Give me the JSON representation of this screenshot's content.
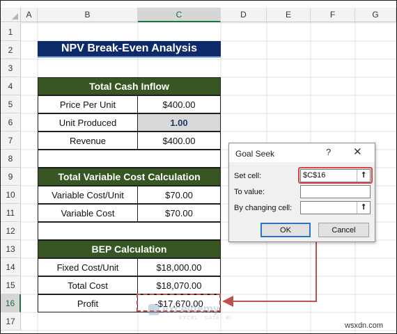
{
  "columns": [
    "A",
    "B",
    "C",
    "D",
    "E",
    "F",
    "G"
  ],
  "rows": [
    "1",
    "2",
    "3",
    "4",
    "5",
    "6",
    "7",
    "8",
    "9",
    "10",
    "11",
    "12",
    "13",
    "14",
    "15",
    "16",
    "17"
  ],
  "title": "NPV Break-Even Analysis",
  "sections": {
    "cash_inflow": {
      "header": "Total Cash Inflow",
      "rows": [
        {
          "label": "Price Per Unit",
          "value": "$400.00"
        },
        {
          "label": "Unit Produced",
          "value": "1.00"
        },
        {
          "label": "Revenue",
          "value": "$400.00"
        }
      ]
    },
    "variable_cost": {
      "header": "Total Variable Cost Calculation",
      "rows": [
        {
          "label": "Variable Cost/Unit",
          "value": "$70.00"
        },
        {
          "label": "Variable Cost",
          "value": "$70.00"
        }
      ]
    },
    "bep": {
      "header": "BEP Calculation",
      "rows": [
        {
          "label": "Fixed Cost/Unit",
          "value": "$18,000.00"
        },
        {
          "label": "Total Cost",
          "value": "$18,070.00"
        },
        {
          "label": "Profit",
          "value": "-$17,670.00"
        }
      ]
    }
  },
  "goal_seek": {
    "title": "Goal Seek",
    "help_glyph": "?",
    "close_glyph": "✕",
    "set_cell_label": "Set cell:",
    "set_cell_value": "$C$16",
    "to_value_label": "To value:",
    "to_value_value": "",
    "changing_cell_label": "By changing cell:",
    "changing_cell_value": "",
    "ref_glyph": "⭡",
    "ok_label": "OK",
    "cancel_label": "Cancel"
  },
  "watermark": {
    "name": "exceldemy",
    "tagline": "EXCEL · DATA · BI"
  },
  "footer_text": "wsxdn.com",
  "colors": {
    "arrow": "#c0504d",
    "title_bg": "#0d2a6b",
    "section_bg": "#375623"
  }
}
